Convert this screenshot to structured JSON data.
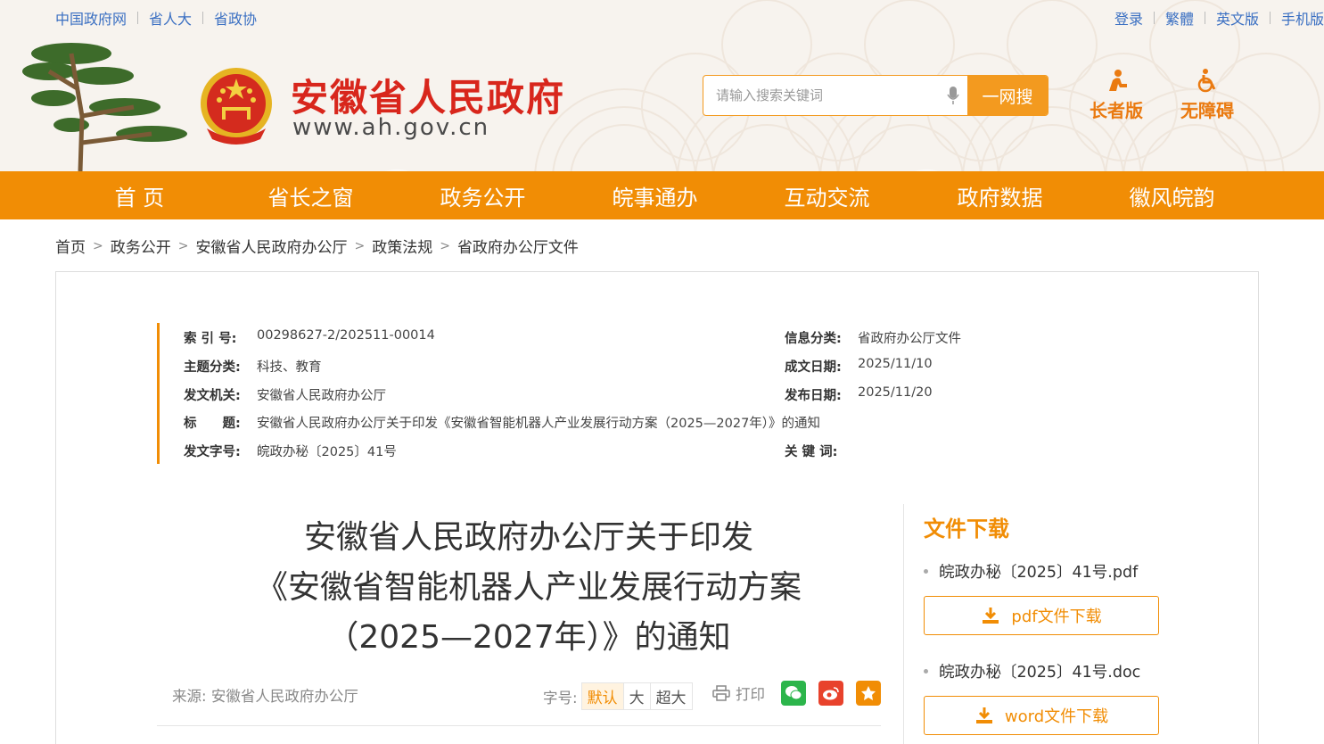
{
  "top_links": [
    "中国政府网",
    "省人大",
    "省政协"
  ],
  "top_right_links": [
    "登录",
    "繁體",
    "英文版",
    "手机版"
  ],
  "site": {
    "title": "安徽省人民政府",
    "url": "www.ah.gov.cn"
  },
  "search": {
    "placeholder": "请输入搜索关键词",
    "button": "一网搜"
  },
  "access": {
    "elder": "长者版",
    "barrier_free": "无障碍"
  },
  "nav": [
    "首 页",
    "省长之窗",
    "政务公开",
    "皖事通办",
    "互动交流",
    "政府数据",
    "徽风皖韵"
  ],
  "breadcrumb": [
    "首页",
    "政务公开",
    "安徽省人民政府办公厅",
    "政策法规",
    "省政府办公厅文件"
  ],
  "meta": {
    "index_key": "索 引 号:",
    "index_val": "00298627-2/202511-00014",
    "info_key": "信息分类:",
    "info_val": "省政府办公厅文件",
    "topic_key": "主题分类:",
    "topic_val": "科技、教育",
    "written_key": "成文日期:",
    "written_val": "2025/11/10",
    "issuer_key": "发文机关:",
    "issuer_val": "安徽省人民政府办公厅",
    "publish_key": "发布日期:",
    "publish_val": "2025/11/20",
    "title_key": "标　　题:",
    "title_val": "安徽省人民政府办公厅关于印发《安徽省智能机器人产业发展行动方案（2025—2027年）》的通知",
    "docno_key": "发文字号:",
    "docno_val": "皖政办秘〔2025〕41号",
    "keyword_key": "关 键 词:",
    "keyword_val": ""
  },
  "doc": {
    "title_line1": "安徽省人民政府办公厅关于印发",
    "title_line2": "《安徽省智能机器人产业发展行动方案",
    "title_line3": "（2025—2027年）》的通知",
    "source_label": "来源:",
    "source": "安徽省人民政府办公厅",
    "font_label": "字号:",
    "font_sizes": [
      "默认",
      "大",
      "超大"
    ],
    "print": "打印"
  },
  "downloads": {
    "title": "文件下载",
    "files": [
      {
        "name": "皖政办秘〔2025〕41号.pdf",
        "button": "pdf文件下载"
      },
      {
        "name": "皖政办秘〔2025〕41号.doc",
        "button": "word文件下载"
      }
    ]
  },
  "colors": {
    "accent": "#f18d05",
    "title_red": "#d8261c",
    "link_blue": "#3a6fc2"
  }
}
